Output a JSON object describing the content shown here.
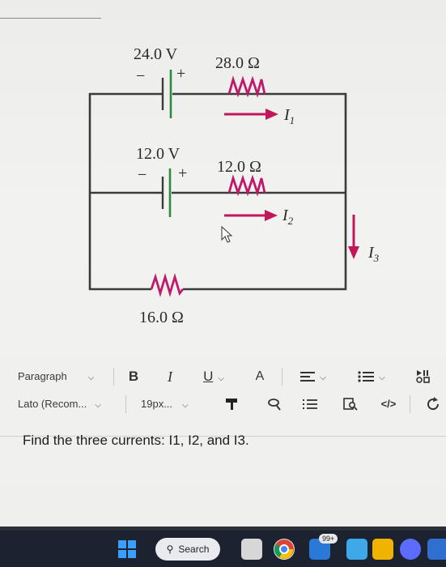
{
  "circuit": {
    "battery1_voltage": "24.0 V",
    "battery2_voltage": "12.0 V",
    "battery_minus": "−",
    "battery_plus": "+",
    "resistor1": "28.0 Ω",
    "resistor2": "12.0 Ω",
    "resistor3": "16.0 Ω",
    "current1_base": "I",
    "current1_sub": "1",
    "current2_base": "I",
    "current2_sub": "2",
    "current3_base": "I",
    "current3_sub": "3",
    "colors": {
      "wire": "#3b3b3b",
      "resistor": "#c0186a",
      "battery": "#2e8b3a",
      "arrow": "#c2185b"
    }
  },
  "toolbar": {
    "paragraph_select": "Paragraph",
    "font_select": "Lato (Recom...",
    "size_select": "19px...",
    "bold": "B",
    "italic": "I",
    "underline": "U",
    "strike": "A",
    "align_icon": "align-icon",
    "list_icon": "list-icon"
  },
  "editor": {
    "content": "Find the three currents: I1, I2, and I3."
  },
  "taskbar": {
    "search_label": "Search",
    "mail_badge": "99+"
  }
}
